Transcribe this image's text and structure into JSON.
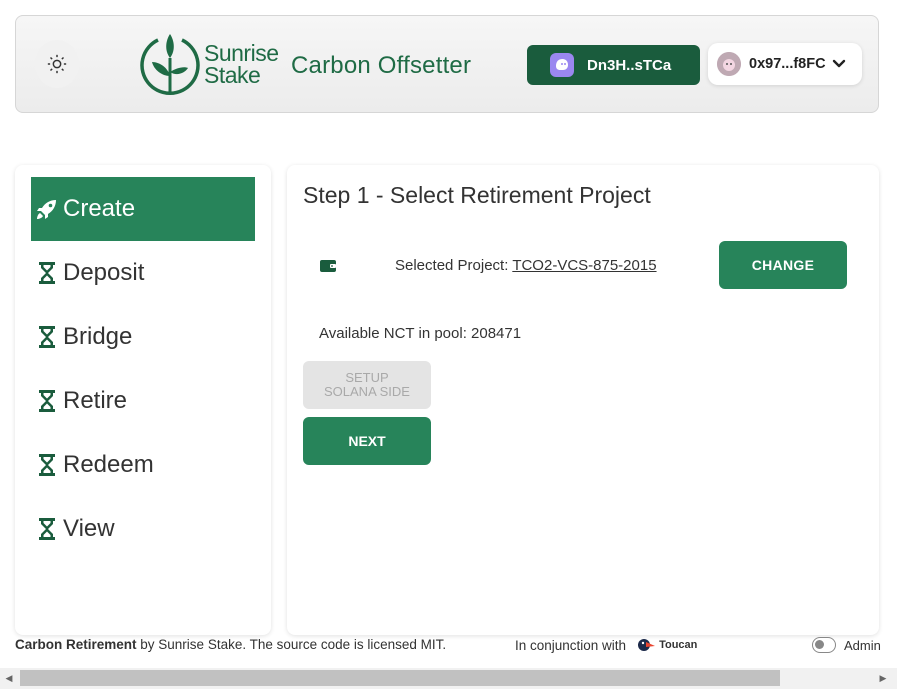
{
  "header": {
    "logo_line1": "Sunrise",
    "logo_line2": "Stake",
    "app_title": "Carbon Offsetter",
    "wallet_label": "Dn3H..sTCa",
    "eth_label": "0x97...f8FC"
  },
  "sidebar": {
    "items": [
      {
        "label": "Create",
        "icon": "rocket-icon",
        "active": true
      },
      {
        "label": "Deposit",
        "icon": "hourglass-icon"
      },
      {
        "label": "Bridge",
        "icon": "hourglass-icon"
      },
      {
        "label": "Retire",
        "icon": "hourglass-icon"
      },
      {
        "label": "Redeem",
        "icon": "hourglass-icon"
      },
      {
        "label": "View",
        "icon": "hourglass-icon"
      }
    ]
  },
  "main": {
    "step_title": "Step 1 - Select Retirement Project",
    "selected_project_label": "Selected Project:",
    "selected_project_value": "TCO2-VCS-875-2015",
    "change_label": "CHANGE",
    "available_label": "Available NCT in pool: 208471",
    "setup_label_line1": "SETUP",
    "setup_label_line2": "SOLANA SIDE",
    "next_label": "NEXT"
  },
  "footer": {
    "brand": "Carbon Retirement",
    "credit": " by Sunrise Stake. The source code is licensed MIT.",
    "conjunction": "In conjunction with",
    "partner": "Toucan",
    "admin_label": "Admin"
  },
  "colors": {
    "primary": "#27845a",
    "dark_green": "#1a5c3d",
    "logo_green": "#1f6b45",
    "wallet_avatar": "#9a87f0"
  }
}
